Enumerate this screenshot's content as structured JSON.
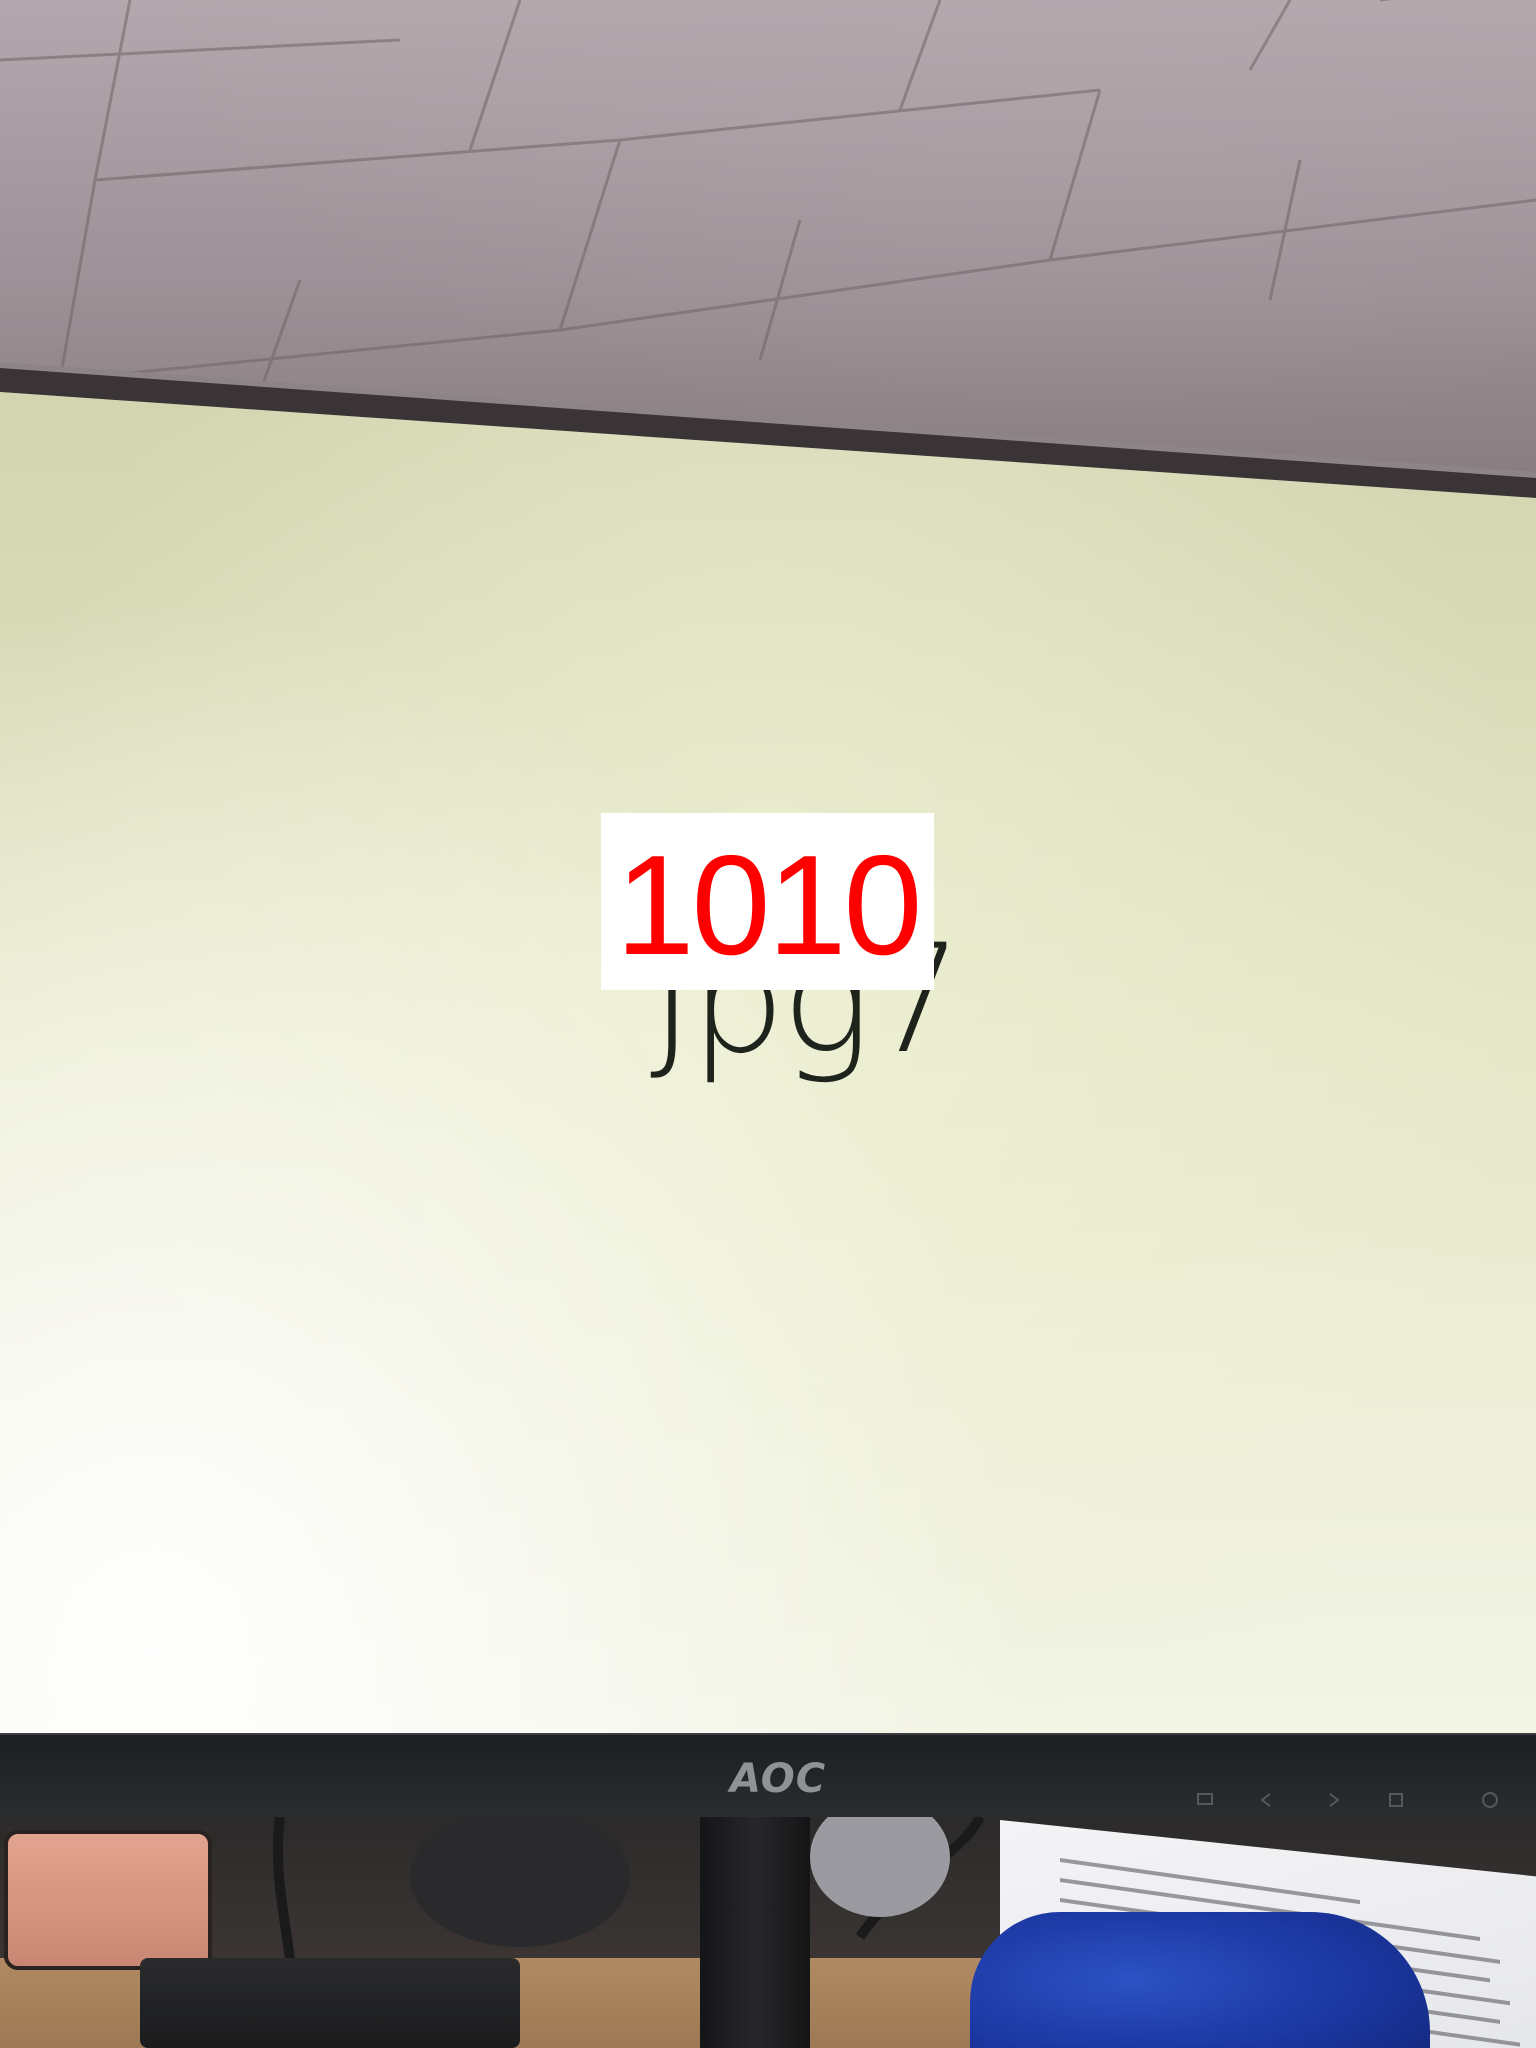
{
  "screen": {
    "text": "Jpg7"
  },
  "label": {
    "text": "1010",
    "color": "#ff0000",
    "background": "#ffffff"
  },
  "monitor": {
    "brand": "AOC"
  }
}
